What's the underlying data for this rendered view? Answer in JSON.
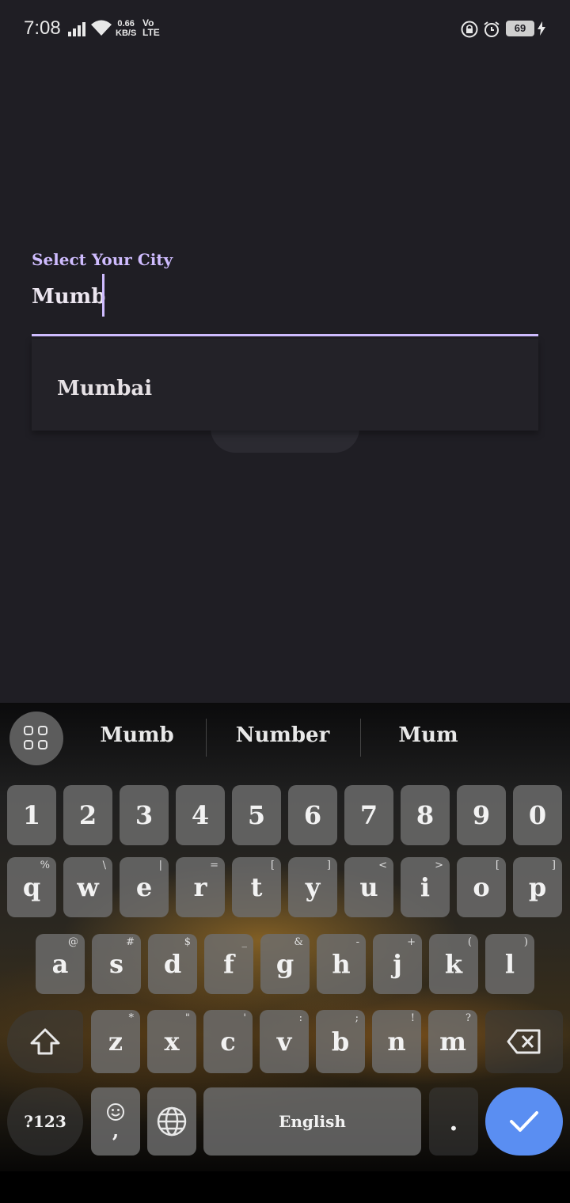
{
  "status_bar": {
    "time": "7:08",
    "speed_value": "0.66",
    "speed_unit": "KB/S",
    "volte_top": "Vo",
    "volte_bottom": "LTE",
    "battery_level": "69"
  },
  "form": {
    "label": "Select Your City",
    "value": "Mumb",
    "suggestions": [
      "Mumbai"
    ]
  },
  "keyboard": {
    "suggestions": [
      "Mumb",
      "Number",
      "Mum"
    ],
    "row_numbers": [
      "1",
      "2",
      "3",
      "4",
      "5",
      "6",
      "7",
      "8",
      "9",
      "0"
    ],
    "row_q": [
      {
        "k": "q",
        "h": "%"
      },
      {
        "k": "w",
        "h": "\\"
      },
      {
        "k": "e",
        "h": "|"
      },
      {
        "k": "r",
        "h": "="
      },
      {
        "k": "t",
        "h": "["
      },
      {
        "k": "y",
        "h": "]"
      },
      {
        "k": "u",
        "h": "<"
      },
      {
        "k": "i",
        "h": ">"
      },
      {
        "k": "o",
        "h": "["
      },
      {
        "k": "p",
        "h": "]"
      }
    ],
    "row_a": [
      {
        "k": "a",
        "h": "@"
      },
      {
        "k": "s",
        "h": "#"
      },
      {
        "k": "d",
        "h": "$"
      },
      {
        "k": "f",
        "h": "_"
      },
      {
        "k": "g",
        "h": "&"
      },
      {
        "k": "h",
        "h": "-"
      },
      {
        "k": "j",
        "h": "+"
      },
      {
        "k": "k",
        "h": "("
      },
      {
        "k": "l",
        "h": ")"
      }
    ],
    "row_z": [
      {
        "k": "z",
        "h": "*"
      },
      {
        "k": "x",
        "h": "\""
      },
      {
        "k": "c",
        "h": "'"
      },
      {
        "k": "v",
        "h": ":"
      },
      {
        "k": "b",
        "h": ";"
      },
      {
        "k": "n",
        "h": "!"
      },
      {
        "k": "m",
        "h": "?"
      }
    ],
    "symbols_key": "?123",
    "comma_key": ",",
    "space_label": "English",
    "period_key": ".",
    "accent_color": "#5a8ef2"
  }
}
